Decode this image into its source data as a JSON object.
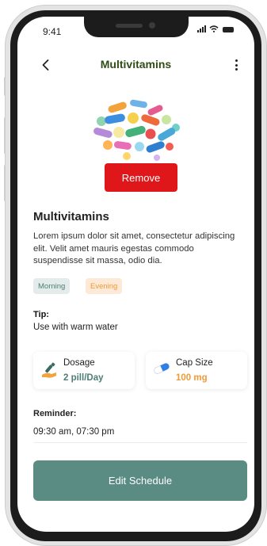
{
  "status_bar": {
    "time": "9:41"
  },
  "header": {
    "title": "Multivitamins"
  },
  "actions": {
    "remove_label": "Remove",
    "edit_label": "Edit Schedule"
  },
  "medicine": {
    "name": "Multivitamins",
    "description": "Lorem ipsum dolor sit amet, consectetur adipiscing elit. Velit amet mauris egestas commodo suspendisse sit massa, odio dia.",
    "tags": [
      "Morning",
      "Evening"
    ],
    "tip_label": "Tip:",
    "tip_text": "Use with warm water"
  },
  "dosage": {
    "label": "Dosage",
    "value": "2 pill/Day"
  },
  "cap_size": {
    "label": "Cap Size",
    "value": "100 mg"
  },
  "reminder": {
    "label": "Reminder:",
    "value": "09:30 am, 07:30 pm"
  },
  "icons": [
    "chevron-left-icon",
    "more-vertical-icon",
    "signal-icon",
    "wifi-icon",
    "battery-icon",
    "pills-image",
    "dropper-hand-icon",
    "capsule-icon"
  ],
  "colors": {
    "title": "#2f4d16",
    "remove": "#e0171a",
    "primary": "#5a8c84",
    "tag_morning_bg": "#e3ecea",
    "tag_morning_text": "#4f7e76",
    "tag_evening_bg": "#fde9d5",
    "tag_evening_text": "#ef9a3a",
    "dosage_value": "#4f7e76",
    "cap_value": "#ef9a3a"
  }
}
